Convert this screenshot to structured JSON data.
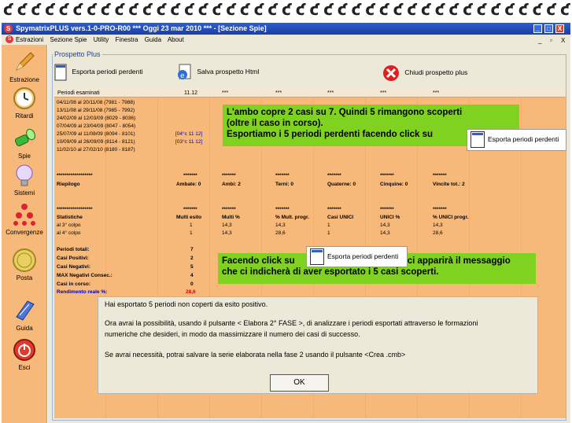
{
  "window": {
    "title": "SpymatrixPLUS vers.1-0-PRO-R00  ***  Oggi 23 mar 2010  ***  - [Sezione Spie]",
    "app_icon": "S",
    "buttons": [
      "_",
      "□",
      "X"
    ]
  },
  "menu": {
    "items": [
      "Estrazioni",
      "Sezione Spie",
      "Utility",
      "Finestra",
      "Guida",
      "About"
    ],
    "mdi_buttons": [
      "_",
      "▫",
      "X"
    ]
  },
  "sidebar": {
    "items": [
      {
        "label": "Estrazione",
        "icon": "pencil-icon"
      },
      {
        "label": "Ritardi",
        "icon": "clock-icon"
      },
      {
        "label": "Spie",
        "icon": "flashlight-icon"
      },
      {
        "label": "Sistemi",
        "icon": "lightbulb-icon"
      },
      {
        "label": "Convergenze",
        "icon": "molecule-icon"
      },
      {
        "label": "Posta",
        "icon": "coin-icon"
      },
      {
        "label": "Guida",
        "icon": "book-icon"
      },
      {
        "label": "Esci",
        "icon": "power-icon"
      }
    ]
  },
  "panel": {
    "title": "Prospetto Plus"
  },
  "toolbar": {
    "export_label": "Esporta periodi perdenti",
    "save_html_label": "Salva prospetto Html",
    "close_label": "Chiudi prospetto plus"
  },
  "table": {
    "header": [
      "Periodi esaminati",
      "11.12",
      "***",
      "***",
      "***",
      "***",
      "***"
    ],
    "periods": [
      "04/11/08 al 20/11/08  (7981 - 7988)",
      "13/11/08 al 29/11/08  (7985 - 7992)",
      "24/02/09 al 12/03/09  (8029 - 8036)",
      "07/04/09 al 23/04/09  (8047 - 8054)",
      "25/07/09 al 11/08/09  (8094 - 8101)",
      "10/09/09 al 26/09/09  (8114 - 8121)",
      "11/02/10 al 27/02/10  (8180 - 8187)"
    ],
    "period_hits": [
      "",
      "",
      "",
      "",
      "[04°c 11 12]",
      "[03°c 11 12]",
      ""
    ],
    "stars_row": [
      "******************",
      "*******",
      "*******",
      "*******",
      "*******",
      "*******",
      "*******"
    ],
    "riepilogo": [
      "Riepilogo",
      "Ambate: 0",
      "Ambi: 2",
      "Terni: 0",
      "Quaterne: 0",
      "Cinquine: 0",
      "Vincite tot.: 2"
    ],
    "stars_row2": [
      "******************",
      "*******",
      "*******",
      "*******",
      "*******",
      "*******",
      "*******"
    ],
    "stat_header": [
      "Statistiche",
      "Multi esito",
      "Multi %",
      "% Mult. progr.",
      "Casi UNICI",
      "UNICI %",
      "% UNICI progr."
    ],
    "stat_rows": [
      [
        "al 3° colpo",
        "1",
        "14,3",
        "14,3",
        "1",
        "14,3",
        "14,3"
      ],
      [
        "al 4° colpo",
        "1",
        "14,3",
        "28,6",
        "1",
        "14,3",
        "28,6"
      ]
    ],
    "summary": [
      {
        "label": "Periodi totali:",
        "value": "7"
      },
      {
        "label": "Casi Positivi:",
        "value": "2"
      },
      {
        "label": "Casi Negativi:",
        "value": "5"
      },
      {
        "label": "MAX Negativi Consec.:",
        "value": "4"
      },
      {
        "label": "Casi in corso:",
        "value": "0"
      },
      {
        "label": "Rendimento reale %:",
        "value": "28,6"
      }
    ]
  },
  "callouts": {
    "top": [
      "L'ambo copre 2 casi su 7. Quindi 5 rimangono scoperti",
      "(oltre il caso in corso).",
      "Esportiamo i 5 periodi perdenti facendo click su"
    ],
    "top_button": "Esporta periodi perdenti",
    "mid_prefix": "Facendo click su",
    "mid_button": "Esporta periodi perdenti",
    "mid_suffix": "ci apparirà il messaggio",
    "mid_line2": "che ci indicherà di aver esportato i 5 casi scoperti."
  },
  "dialog": {
    "line1": "Hai esportato 5 periodi non coperti da esito positivo.",
    "line2": "Ora avrai la possibilità, usando il pulsante < Elabora 2° FASE >, di analizzare i periodi esportati attraverso le formazioni",
    "line3": "numeriche che desideri, in modo da massimizzare il numero dei casi di successo.",
    "line4": "Se avrai necessità, potrai salvare la serie elaborata nella fase 2 usando il pulsante <Crea .cmb>",
    "ok": "OK"
  }
}
